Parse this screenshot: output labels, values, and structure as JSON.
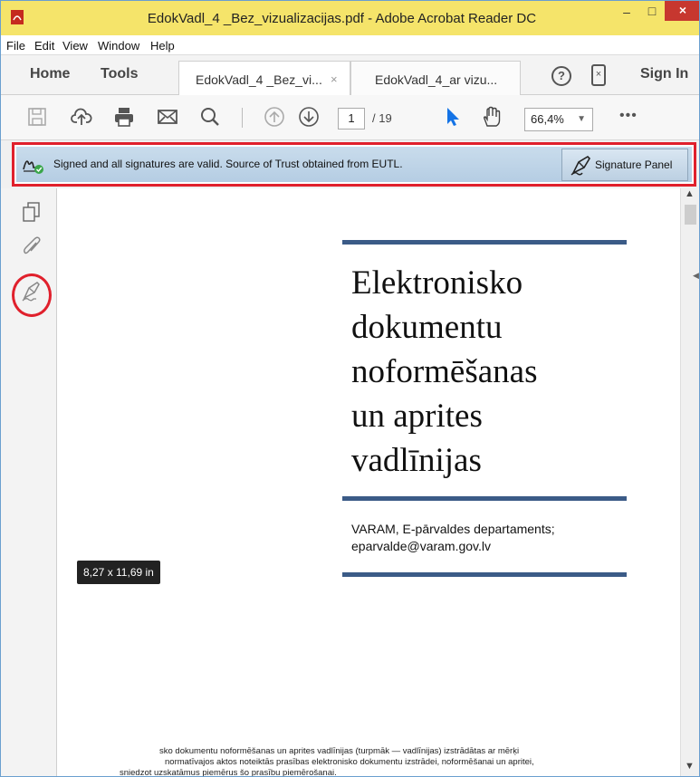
{
  "window": {
    "title": "EdokVadl_4 _Bez_vizualizacijas.pdf - Adobe Acrobat Reader DC",
    "minimize": "–",
    "maximize": "□",
    "close": "×"
  },
  "menu": [
    "File",
    "Edit",
    "View",
    "Window",
    "Help"
  ],
  "tabs": {
    "home": "Home",
    "tools": "Tools",
    "doc_tabs": [
      {
        "label": "EdokVadl_4 _Bez_vi...",
        "close": "×",
        "active": true
      },
      {
        "label": "EdokVadl_4_ar vizu...",
        "active": false
      }
    ],
    "help": "?",
    "sign_in": "Sign In"
  },
  "toolbar": {
    "page_current": "1",
    "page_total": "/ 19",
    "zoom": "66,4%",
    "more": "•••",
    "icons": [
      "save-icon",
      "upload-icon",
      "print-icon",
      "email-icon",
      "search-icon",
      "page-up-icon",
      "page-down-icon",
      "select-cursor-icon",
      "hand-icon"
    ]
  },
  "signature_bar": {
    "message": "Signed and all signatures are valid. Source of Trust obtained from EUTL.",
    "panel_button": "Signature Panel"
  },
  "left_panel": {
    "icons": [
      "page-thumbnails-icon",
      "attachments-icon",
      "signatures-icon"
    ]
  },
  "document": {
    "title_lines": [
      "Elektronisko",
      "dokumentu",
      "noformēšanas",
      "un aprites",
      "vadlīnijas"
    ],
    "author_line1": "VARAM, E-pārvaldes departaments;",
    "author_line2": "eparvalde@varam.gov.lv",
    "footnote_line1": "sko dokumentu noformēšanas un aprites vadlīnijas (turpmāk — vadlīnijas) izstrādātas ar mērķi",
    "footnote_line2": "normatīvajos aktos noteiktās prasības elektronisko dokumentu izstrādei, noformēšanai un apritei,",
    "footnote_line3": "sniedzot uzskatāmus piemērus šo prasību piemērošanai.",
    "page_size_tooltip": "8,27 x 11,69 in"
  },
  "colors": {
    "title_bar": "#f5e46a",
    "close_button": "#c7372f",
    "signature_bar": "#bcd2e7",
    "highlight_red": "#e0202c",
    "doc_rule": "#3b5b87"
  }
}
